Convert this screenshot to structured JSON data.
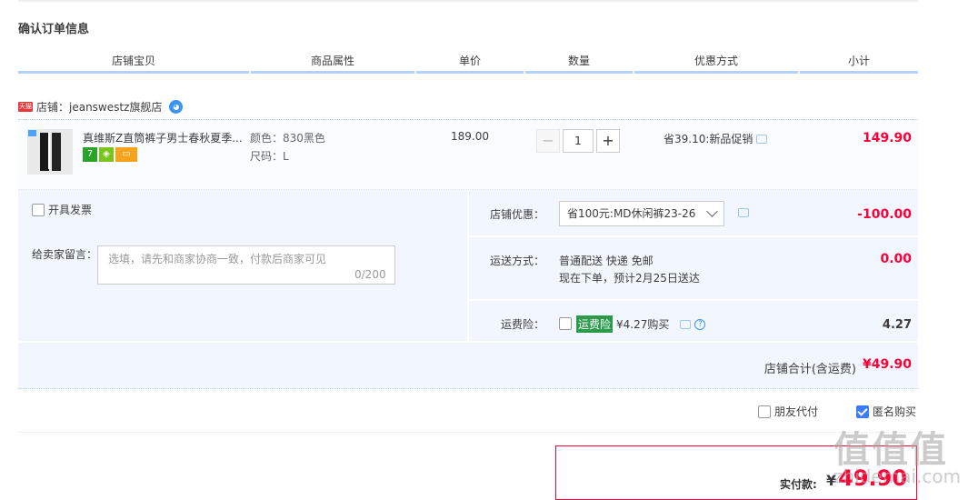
{
  "title": "确认订单信息",
  "columns": [
    "店铺宝贝",
    "商品属性",
    "单价",
    "数量",
    "优惠方式",
    "小计"
  ],
  "shop": {
    "badge": "天猫",
    "label": "店铺：jeanswestz旗舰店"
  },
  "item": {
    "name": "真维斯Z直筒裤子男士春秋夏季...",
    "badge_7": "7",
    "attr_color": "颜色：830黑色",
    "attr_size": "尺码：L",
    "price": "189.00",
    "qty_minus": "−",
    "qty_value": "1",
    "qty_plus": "+",
    "promo": "省39.10:新品促销",
    "subtotal": "149.90"
  },
  "invoice": {
    "label": "开具发票",
    "checked": false
  },
  "message": {
    "label": "给卖家留言：",
    "placeholder": "选填，请先和商家协商一致，付款后商家可见",
    "count": "0/200"
  },
  "discount": {
    "label": "店铺优惠：",
    "selected": "省100元:MD休闲裤23-26",
    "amount": "-100.00"
  },
  "shipping": {
    "label": "运送方式：",
    "method": "普通配送 快递 免邮",
    "eta": "现在下单，预计2月25日送达",
    "amount": "0.00"
  },
  "freight_insurance": {
    "label": "运费险：",
    "tag": "运费险",
    "text": "¥4.27购买",
    "amount": "4.27",
    "help": "?"
  },
  "shop_total": {
    "label": "店铺合计(含运费)",
    "amount": "¥49.90"
  },
  "options": {
    "friend_pay": "朋友代付",
    "anonymous": "匿名购买",
    "anonymous_checked": true
  },
  "payment": {
    "label": "实付款:",
    "currency": "¥",
    "amount": "49.90"
  },
  "watermark": {
    "main": "值值值",
    "sub": "zhidemai.com"
  },
  "colors": {
    "accent_red": "#ff0036",
    "header_line": "#b2d1ff",
    "panel_bg": "#f2f7ff"
  }
}
